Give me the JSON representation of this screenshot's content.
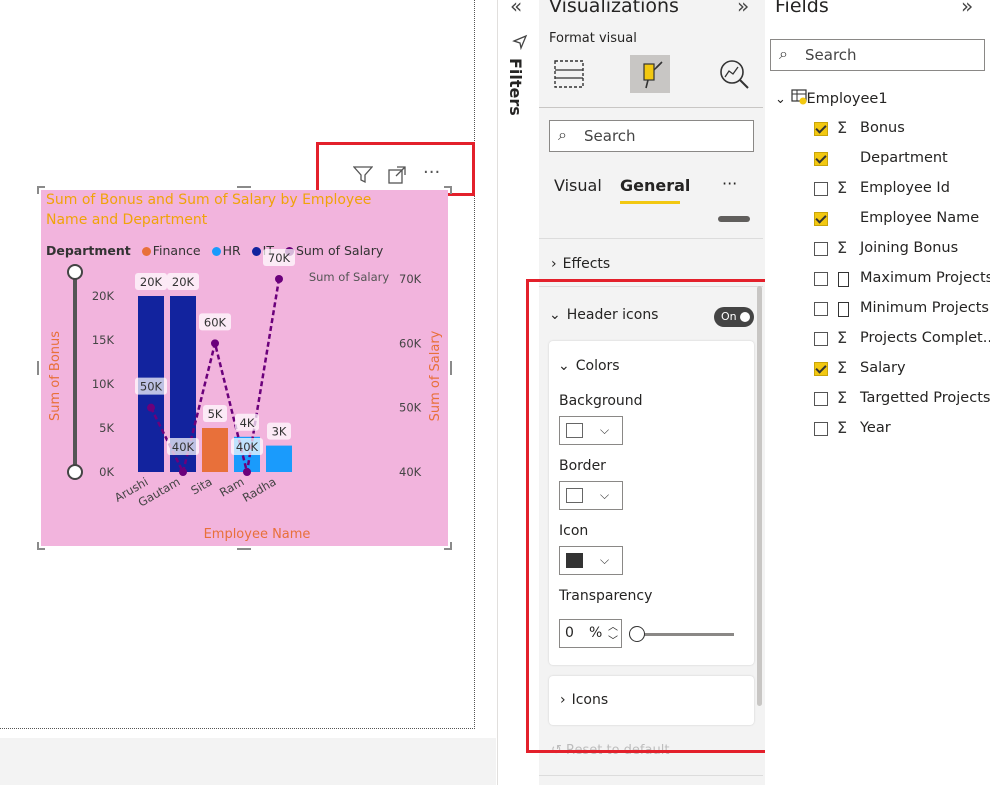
{
  "chart": {
    "title": "Sum of Bonus and Sum of Salary by Employee Name and Department",
    "legend": {
      "heading": "Department",
      "items": [
        {
          "label": "Finance",
          "color": "#e8703a"
        },
        {
          "label": "HR",
          "color": "#1a9bfc"
        },
        {
          "label": "IT",
          "color": "#12239e"
        },
        {
          "label": "Sum of Salary",
          "color": "#6b007b"
        }
      ]
    },
    "secondary_axis_title": "Sum of Salary"
  },
  "chart_data": {
    "type": "bar",
    "title": "Sum of Bonus and Sum of Salary by Employee Name and Department",
    "xlabel": "Employee Name",
    "ylabel": "Sum of Bonus",
    "y2label": "Sum of Salary",
    "categories": [
      "Arushi",
      "Gautam",
      "Sita",
      "Ram",
      "Radha"
    ],
    "bonus": [
      {
        "category": "Arushi",
        "department": "IT",
        "value": 20000,
        "label": "20K",
        "color": "#12239e"
      },
      {
        "category": "Gautam",
        "department": "IT",
        "value": 20000,
        "label": "20K",
        "color": "#12239e"
      },
      {
        "category": "Sita",
        "department": "Finance",
        "value": 5000,
        "label": "5K",
        "color": "#e8703a"
      },
      {
        "category": "Ram",
        "department": "HR",
        "value": 4000,
        "label": "4K",
        "color": "#1a9bfc"
      },
      {
        "category": "Radha",
        "department": "HR",
        "value": 3000,
        "label": "3K",
        "color": "#1a9bfc"
      }
    ],
    "salary": [
      {
        "category": "Arushi",
        "value": 50000,
        "label": "50K"
      },
      {
        "category": "Gautam",
        "value": 40000,
        "label": "40K"
      },
      {
        "category": "Sita",
        "value": 60000,
        "label": "60K"
      },
      {
        "category": "Ram",
        "value": 40000,
        "label": "40K"
      },
      {
        "category": "Radha",
        "value": 70000,
        "label": "70K"
      }
    ],
    "salary_color": "#6b007b",
    "y_ticks": [
      "0K",
      "5K",
      "10K",
      "15K",
      "20K"
    ],
    "y_tick_values": [
      0,
      5000,
      10000,
      15000,
      20000
    ],
    "y2_ticks": [
      "40K",
      "50K",
      "60K",
      "70K"
    ],
    "y2_tick_values": [
      40000,
      50000,
      60000,
      70000
    ]
  },
  "filters": {
    "label": "Filters",
    "collapse_icon": "double-chevron-left-icon"
  },
  "visualizations": {
    "title": "Visualizations",
    "format_visual_label": "Format visual",
    "search_placeholder": "Search",
    "tabs": [
      {
        "label": "Visual"
      },
      {
        "label": "General"
      }
    ],
    "more": "···",
    "effects_label": "Effects",
    "header_icons_label": "Header icons",
    "toggle_label": "On",
    "colors_label": "Colors",
    "background_label": "Background",
    "border_label": "Border",
    "icon_label": "Icon",
    "transparency_label": "Transparency",
    "transparency_value": "0",
    "transparency_unit": "%",
    "icons_label": "Icons",
    "reset_label": "Reset to default",
    "background_color": "#ffffff",
    "border_color": "#ffffff",
    "icon_color": "#333333"
  },
  "fields": {
    "title": "Fields",
    "search_placeholder": "Search",
    "table_name": "Employee1",
    "items": [
      {
        "label": "Bonus",
        "checked": true,
        "type": "sigma"
      },
      {
        "label": "Department",
        "checked": true,
        "type": "none"
      },
      {
        "label": "Employee Id",
        "checked": false,
        "type": "sigma"
      },
      {
        "label": "Employee Name",
        "checked": true,
        "type": "none"
      },
      {
        "label": "Joining Bonus",
        "checked": false,
        "type": "sigma"
      },
      {
        "label": "Maximum Projects",
        "checked": false,
        "type": "calc"
      },
      {
        "label": "Minimum Projects",
        "checked": false,
        "type": "calc"
      },
      {
        "label": "Projects Complet...",
        "checked": false,
        "type": "sigma"
      },
      {
        "label": "Salary",
        "checked": true,
        "type": "sigma"
      },
      {
        "label": "Targetted Projects",
        "checked": false,
        "type": "sigma"
      },
      {
        "label": "Year",
        "checked": false,
        "type": "sigma"
      }
    ]
  }
}
